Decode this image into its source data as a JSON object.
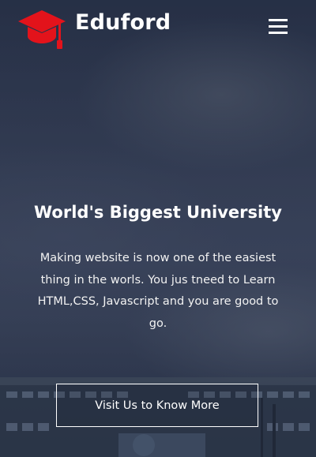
{
  "header": {
    "brand": "Eduford",
    "logo_icon": "graduation-cap-icon",
    "menu_icon": "hamburger-menu-icon"
  },
  "hero": {
    "title": "World's Biggest University",
    "description": "Making website is now one of the easiest thing in the worls. You jus tneed to Learn HTML,CSS, Javascript and you are good to go.",
    "cta_label": "Visit Us to Know More"
  },
  "colors": {
    "accent": "#e3131b",
    "text": "#ffffff",
    "overlay": "#1c2438"
  }
}
